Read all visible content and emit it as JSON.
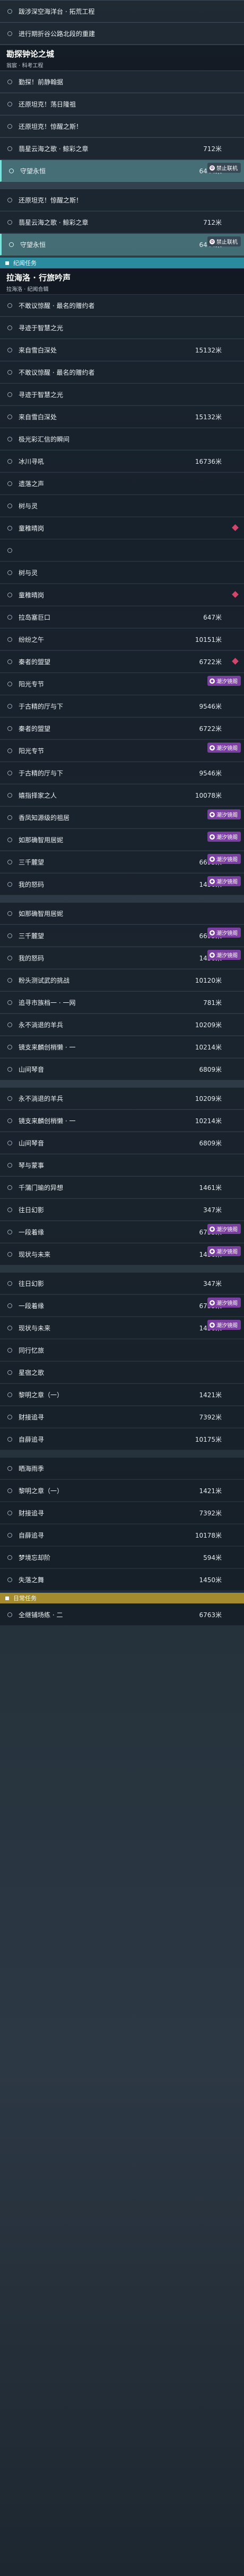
{
  "top_rows": [
    {
      "title": "跋涉深空海洋台 · 拓荒工程",
      "right": "",
      "state": "normal"
    },
    {
      "title": "进行期折谷公路北段的重建",
      "right": "",
      "state": "normal"
    },
    {
      "type": "area",
      "title": "勘探钟论之城",
      "sub": "翁宸 · 科考工程"
    },
    {
      "title": "勤探！前静翰据",
      "right": "",
      "state": "normal"
    },
    {
      "title": "还原坦克！荡日隆祖",
      "right": "",
      "state": "normal"
    },
    {
      "title": "还原坦克！惊醒之斯！",
      "right": "",
      "state": "normal"
    },
    {
      "title": "翡星云海之歌 · 鲸彩之章",
      "right": "712米",
      "state": "normal"
    },
    {
      "title": "守望永恒",
      "right": "6444米",
      "state": "highlight",
      "badge": "禁止联机",
      "badge_kind": "offline"
    },
    {
      "title": "还原坦克！惊醒之斯！",
      "right": "",
      "state": "normal",
      "gap": true
    },
    {
      "title": "翡星云海之歌 · 鲸彩之章",
      "right": "712米",
      "state": "normal"
    },
    {
      "title": "守望永恒",
      "right": "6444米",
      "state": "highlight",
      "badge": "禁止联机",
      "badge_kind": "offline"
    }
  ],
  "section1": {
    "label": "纪闻任务"
  },
  "area2": {
    "title": "拉海洛 · 行旅吟声",
    "sub": "拉海洛 · 纪闻合辑"
  },
  "rows2": [
    {
      "title": "不敢议惊醒 · 最名的赠约者",
      "right": "",
      "state": "normal"
    },
    {
      "title": "寻迹于智慧之光",
      "right": "",
      "state": "normal"
    },
    {
      "title": "来自雪白深处",
      "right": "15132米",
      "state": "normal"
    },
    {
      "title": "不敢议惊醒 · 最名的赠约者",
      "right": "",
      "state": "normal"
    },
    {
      "title": "寻迹于智慧之光",
      "right": "",
      "state": "normal"
    },
    {
      "title": "来自雪白深处",
      "right": "15132米",
      "state": "normal"
    },
    {
      "title": "极光彩汇信的瞬间",
      "right": "",
      "state": "normal"
    },
    {
      "title": "冰川寻吼",
      "right": "16736米",
      "state": "normal"
    },
    {
      "title": "遗落之声",
      "right": "",
      "state": "normal"
    },
    {
      "title": "树与灵",
      "right": "",
      "state": "normal"
    },
    {
      "title": "童稚晴岗",
      "right": "",
      "state": "normal",
      "diamond": true
    },
    {
      "title": "",
      "right": "",
      "state": "normal"
    },
    {
      "title": "树与灵",
      "right": "",
      "state": "normal"
    },
    {
      "title": "童稚晴岗",
      "right": "",
      "state": "normal",
      "diamond": true
    },
    {
      "title": "拉岛塞巨口",
      "right": "647米",
      "state": "normal"
    },
    {
      "title": "纷纷之午",
      "right": "10151米",
      "state": "normal"
    },
    {
      "title": "秦者的盟望",
      "right": "6722米",
      "state": "normal",
      "diamond": true
    },
    {
      "title": "阳光专节",
      "right": "",
      "state": "normal",
      "badge": "潮汐镜阁",
      "badge_kind": "purple"
    },
    {
      "title": "于古精的厅与下",
      "right": "9546米",
      "state": "normal"
    },
    {
      "title": "秦者的盟望",
      "right": "6722米",
      "state": "normal"
    },
    {
      "title": "阳光专节",
      "right": "",
      "state": "normal",
      "badge": "潮汐镜阁",
      "badge_kind": "purple"
    },
    {
      "title": "于古精的厅与下",
      "right": "9546米",
      "state": "normal"
    },
    {
      "title": "嬉指择家之人",
      "right": "10078米",
      "state": "normal"
    },
    {
      "title": "香凤知源级的祖居",
      "right": "",
      "state": "normal",
      "badge": "潮汐镜阁",
      "badge_kind": "purple"
    },
    {
      "title": "如那确智用居妮",
      "right": "",
      "state": "normal",
      "badge": "潮汐镜阁",
      "badge_kind": "purple"
    },
    {
      "title": "三千麓望",
      "right": "6693米",
      "state": "normal",
      "badge": "潮汐镜阁",
      "badge_kind": "purple"
    },
    {
      "title": "我的怒码",
      "right": "1450米",
      "state": "normal",
      "badge": "潮汐镜阁",
      "badge_kind": "purple"
    },
    {
      "title": "如那确智用居妮",
      "right": "",
      "state": "normal",
      "gap": true
    },
    {
      "title": "三千麓望",
      "right": "6693米",
      "state": "normal",
      "badge": "潮汐镜阁",
      "badge_kind": "purple"
    },
    {
      "title": "我的怒码",
      "right": "1450米",
      "state": "normal",
      "badge": "潮汐镜阁",
      "badge_kind": "purple"
    },
    {
      "title": "粉头测试武的挑战",
      "right": "10120米",
      "state": "normal"
    },
    {
      "title": "追寻市族档一 · 一网",
      "right": "781米",
      "state": "normal"
    },
    {
      "title": "永不淌退的羊兵",
      "right": "10209米",
      "state": "normal"
    },
    {
      "title": "镜支来麟创梢懒 · 一",
      "right": "10214米",
      "state": "normal"
    },
    {
      "title": "山间琴音",
      "right": "6809米",
      "state": "normal"
    },
    {
      "title": "永不淌退的羊兵",
      "right": "10209米",
      "state": "normal",
      "gap": true
    },
    {
      "title": "镜支来麟创梢懒 · 一",
      "right": "10214米",
      "state": "normal"
    },
    {
      "title": "山间琴音",
      "right": "6809米",
      "state": "normal"
    },
    {
      "title": "琴与蒙事",
      "right": "",
      "state": "normal"
    },
    {
      "title": "千蒲门瑜的异想",
      "right": "1461米",
      "state": "normal"
    },
    {
      "title": "往日幻影",
      "right": "347米",
      "state": "normal"
    },
    {
      "title": "一段着缘",
      "right": "6735米",
      "state": "normal",
      "badge": "潮汐镜阁",
      "badge_kind": "purple"
    },
    {
      "title": "现状与未来",
      "right": "1450米",
      "state": "normal",
      "badge": "潮汐镜阁",
      "badge_kind": "purple"
    },
    {
      "title": "往日幻影",
      "right": "347米",
      "state": "normal",
      "gap": true
    },
    {
      "title": "一段着缘",
      "right": "6735米",
      "state": "normal",
      "badge": "潮汐镜阁",
      "badge_kind": "purple"
    },
    {
      "title": "现状与未来",
      "right": "1450米",
      "state": "normal",
      "badge": "潮汐镜阁",
      "badge_kind": "purple"
    },
    {
      "title": "同行忆旅",
      "right": "",
      "state": "normal"
    },
    {
      "title": "星宿之歌",
      "right": "",
      "state": "normal"
    },
    {
      "title": "黎明之章（一）",
      "right": "1421米",
      "state": "normal"
    },
    {
      "title": "财接追寻",
      "right": "7392米",
      "state": "normal"
    },
    {
      "title": "自薛追寻",
      "right": "10175米",
      "state": "normal"
    },
    {
      "title": "晒海雨季",
      "right": "",
      "state": "normal",
      "gap": true
    },
    {
      "title": "黎明之章（一）",
      "right": "1421米",
      "state": "normal"
    },
    {
      "title": "财接追寻",
      "right": "7392米",
      "state": "normal"
    },
    {
      "title": "自薛追寻",
      "right": "10178米",
      "state": "normal"
    },
    {
      "title": "梦境忘却阶",
      "right": "594米",
      "state": "normal"
    },
    {
      "title": "失落之舞",
      "right": "1450米",
      "state": "normal"
    }
  ],
  "section2": {
    "label": "日常任务"
  },
  "rows3": [
    {
      "title": "全继铺场练 · 二",
      "right": "6763米",
      "state": "normal"
    }
  ]
}
